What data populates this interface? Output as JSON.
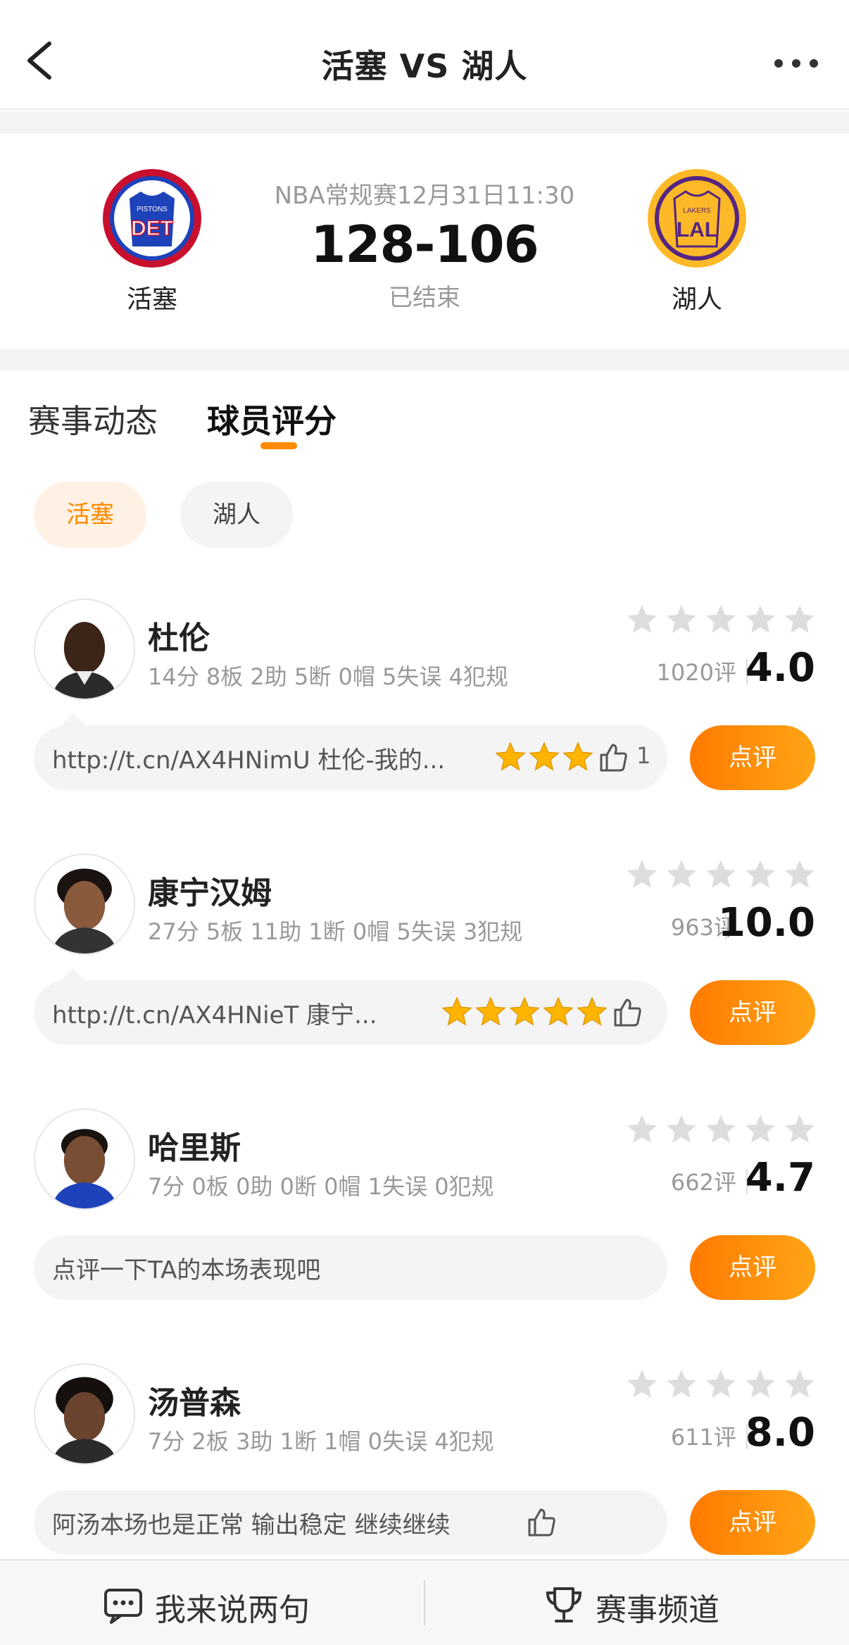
{
  "header": {
    "title": "活塞 VS 湖人",
    "back_icon": "chevron-left-icon",
    "more_icon": "ellipsis-icon"
  },
  "match": {
    "home": {
      "name": "活塞",
      "logo_lines": [
        "PISTONS",
        "DET"
      ],
      "logo_colors": {
        "outer": "#c8102e",
        "inner": "#1d42ba"
      }
    },
    "away": {
      "name": "湖人",
      "logo_lines": [
        "LAKERS",
        "LAL"
      ],
      "logo_colors": {
        "outer": "#fdb927",
        "inner": "#552583"
      }
    },
    "meta": "NBA常规赛12月31日11:30",
    "score": "128-106",
    "status": "已结束"
  },
  "tabs": [
    {
      "label": "赛事动态",
      "active": false
    },
    {
      "label": "球员评分",
      "active": true
    }
  ],
  "team_filter": [
    {
      "label": "活塞",
      "active": true
    },
    {
      "label": "湖人",
      "active": false
    }
  ],
  "players": [
    {
      "name": "杜伦",
      "stats": "14分 8板 2助 5断 0帽 5失误 4犯规",
      "votes": "1020评",
      "score": "4.0",
      "comment": "http://t.cn/AX4HNimU 杜伦-我的...",
      "comment_stars": 3,
      "likes": "1",
      "button": "点评"
    },
    {
      "name": "康宁汉姆",
      "stats": "27分 5板 11助 1断 0帽 5失误 3犯规",
      "votes": "963评",
      "score": "10.0",
      "comment": "http://t.cn/AX4HNieT 康宁...",
      "comment_stars": 5,
      "likes": "",
      "button": "点评"
    },
    {
      "name": "哈里斯",
      "stats": "7分 0板 0助 0断 0帽 1失误 0犯规",
      "votes": "662评",
      "score": "4.7",
      "comment": "点评一下TA的本场表现吧",
      "comment_stars": 0,
      "likes": "",
      "button": "点评"
    },
    {
      "name": "汤普森",
      "stats": "7分 2板 3助 1断 1帽 0失误 4犯规",
      "votes": "611评",
      "score": "8.0",
      "comment": "阿汤本场也是正常 输出稳定 继续继续",
      "comment_stars": 0,
      "likes": "",
      "button": "点评"
    }
  ],
  "bottom": {
    "left": "我来说两句",
    "right": "赛事频道",
    "left_icon": "comment-icon",
    "right_icon": "trophy-icon"
  },
  "colors": {
    "accent": "#ff8a00",
    "star_gray": "#dddddd",
    "star_gold": "#ffb400"
  }
}
